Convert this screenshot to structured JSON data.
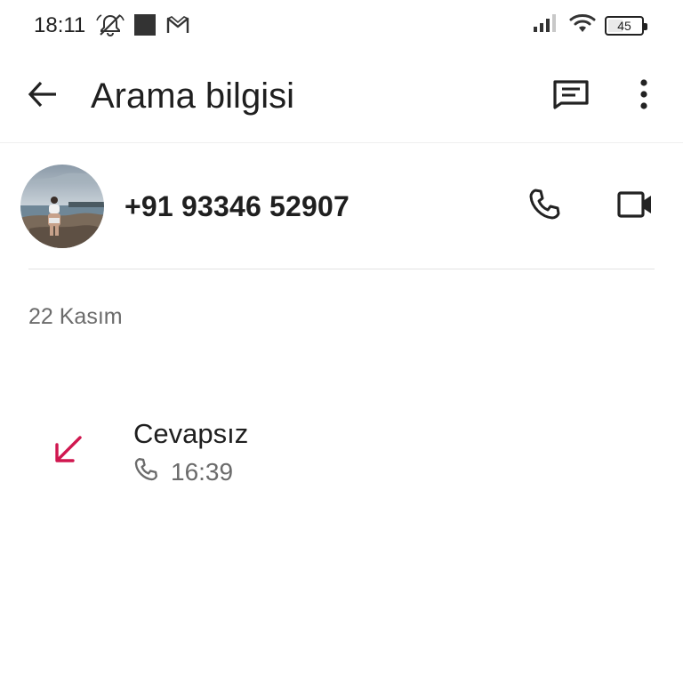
{
  "status_bar": {
    "time": "18:11",
    "battery_level": "45",
    "battery_fraction": 0.45,
    "left_icons": [
      "mute-notifications-icon",
      "square-notification-icon",
      "gmail-icon"
    ],
    "right_icons": [
      "signal-icon",
      "wifi-icon",
      "battery-icon"
    ]
  },
  "app_bar": {
    "title": "Arama bilgisi",
    "icons": [
      "back-arrow-icon",
      "message-icon",
      "more-vert-icon"
    ]
  },
  "contact": {
    "phone_number": "+91 93346 52907",
    "actions": [
      "phone-icon",
      "video-call-icon"
    ]
  },
  "history": {
    "date": "22 Kasım",
    "entries": [
      {
        "status": "Cevapsız",
        "time": "16:39",
        "type_icon": "missed-call-arrow-icon",
        "call_icon": "phone-small-icon"
      }
    ]
  },
  "colors": {
    "missed_call": "#d0174f",
    "text_primary": "#1f1f1f",
    "text_secondary": "#6b6b6b",
    "divider": "#e3e3e3"
  }
}
